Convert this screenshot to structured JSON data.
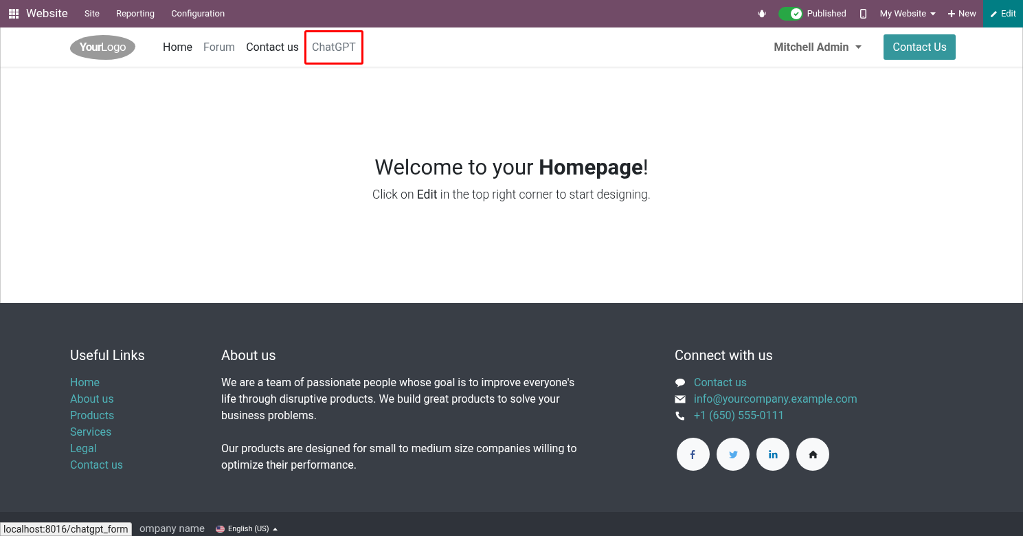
{
  "topbar": {
    "app_name": "Website",
    "menus": [
      "Site",
      "Reporting",
      "Configuration"
    ],
    "published": {
      "on": true,
      "label": "Published"
    },
    "website_menu": "My Website",
    "new_button": "New",
    "edit_button": "Edit"
  },
  "navbar": {
    "logo": {
      "bold": "Your",
      "light": "Logo"
    },
    "items": [
      {
        "label": "Home",
        "kind": "dark",
        "highlighted": false
      },
      {
        "label": "Forum",
        "kind": "muted",
        "highlighted": false
      },
      {
        "label": "Contact us",
        "kind": "dark",
        "highlighted": false
      },
      {
        "label": "ChatGPT",
        "kind": "muted",
        "highlighted": true
      }
    ],
    "user": "Mitchell Admin",
    "cta": "Contact Us"
  },
  "hero": {
    "title": "Welcome to your **Homepage**!",
    "subtitle": "Click on **Edit** in the top right corner to start designing."
  },
  "footer": {
    "useful_links": {
      "heading": "Useful Links",
      "links": [
        "Home",
        "About us",
        "Products",
        "Services",
        "Legal",
        "Contact us"
      ]
    },
    "about": {
      "heading": "About us",
      "paragraphs": [
        "We are a team of passionate people whose goal is to improve everyone's life through disruptive products. We build great products to solve your business problems.",
        "Our products are designed for small to medium size companies willing to optimize their performance."
      ]
    },
    "connect": {
      "heading": "Connect with us",
      "contacts": [
        {
          "kind": "chat",
          "text": "Contact us"
        },
        {
          "kind": "mail",
          "text": "info@yourcompany.example.com"
        },
        {
          "kind": "phone",
          "text": "+1 (650) 555-0111"
        }
      ],
      "social": [
        {
          "kind": "facebook"
        },
        {
          "kind": "twitter"
        },
        {
          "kind": "linkedin"
        },
        {
          "kind": "home"
        }
      ]
    }
  },
  "bottom_bar": {
    "copyright": "ompany name",
    "language": "English (US)"
  },
  "status_tooltip": "localhost:8016/chatgpt_form"
}
